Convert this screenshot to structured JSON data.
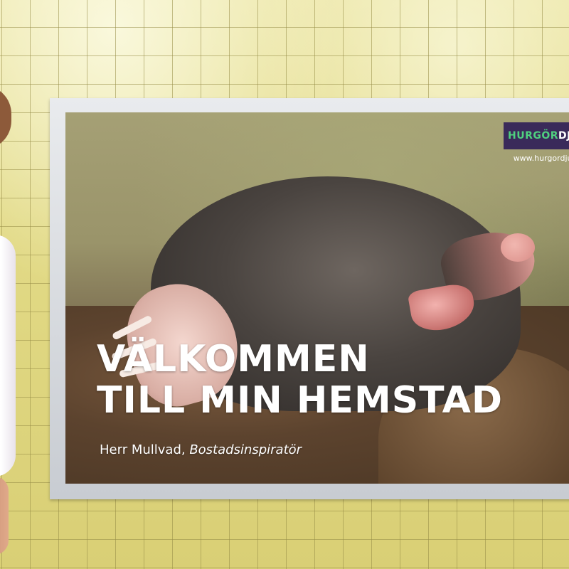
{
  "poster": {
    "brand": {
      "part1": "HURGÖR",
      "part2": "DJUR",
      "url": "www.hurgordjur.se"
    },
    "headline": {
      "line1": "VÄLKOMMEN",
      "line2": "TILL MIN HEMSTAD"
    },
    "subline": {
      "name": "Herr Mullvad, ",
      "title": "Bostadsinspiratör"
    }
  },
  "colors": {
    "tile_wall": "#e5de8f",
    "frame": "#dfe2e6",
    "brand_box": "#3a2a5a",
    "brand_green": "#4fd07f",
    "text": "#ffffff"
  }
}
